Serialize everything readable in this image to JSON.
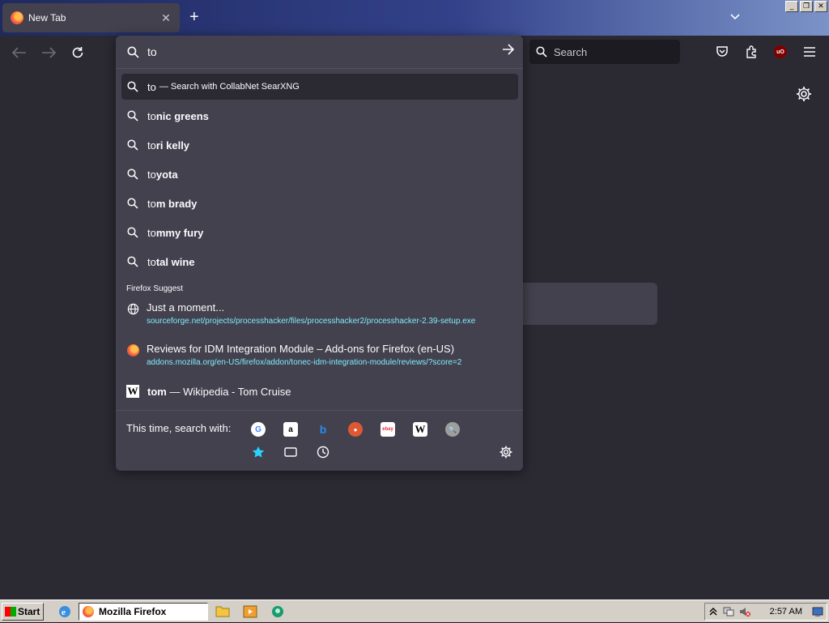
{
  "tab": {
    "title": "New Tab",
    "close": "✕"
  },
  "toolbar": {
    "search_placeholder": "Search"
  },
  "urlbar": {
    "typed": "to"
  },
  "results": {
    "heuristic": {
      "typed": "to",
      "suffix": "— Search with CollabNet SearXNG"
    },
    "suggestions": [
      {
        "prefix": "to",
        "completion": "nic greens"
      },
      {
        "prefix": "to",
        "completion": "ri kelly"
      },
      {
        "prefix": "to",
        "completion": "yota"
      },
      {
        "prefix": "to",
        "completion": "m brady"
      },
      {
        "prefix": "to",
        "completion": "mmy fury"
      },
      {
        "prefix": "to",
        "completion": "tal wine"
      }
    ],
    "group_label": "Firefox Suggest",
    "rich": [
      {
        "title": "Just a moment...",
        "url": "sourceforge.net/projects/processhacker/files/processhacker2/processhacker-2.39-setup.exe"
      },
      {
        "title": "Reviews for IDM Integration Module – Add-ons for Firefox (en-US)",
        "url": "addons.mozilla.org/en-US/firefox/addon/tonec-idm-integration-module/reviews/?score=2"
      }
    ],
    "wiki": {
      "typed": "tom",
      "rest": "— Wikipedia - Tom Cruise",
      "icon_letter": "W"
    }
  },
  "one_off": {
    "label": "This time, search with:",
    "engines": [
      {
        "name": "google",
        "glyph": "G",
        "bg": "#ffffff",
        "fg": "#4285f4"
      },
      {
        "name": "amazon",
        "glyph": "a",
        "bg": "#ffffff",
        "fg": "#000000"
      },
      {
        "name": "bing",
        "glyph": "b",
        "bg": "transparent",
        "fg": "#2a8be8"
      },
      {
        "name": "duckduckgo",
        "glyph": "●",
        "bg": "#de5833",
        "fg": "#ffffff"
      },
      {
        "name": "ebay",
        "glyph": "ebay",
        "bg": "#ffffff",
        "fg": "#e53238"
      },
      {
        "name": "wikipedia",
        "glyph": "W",
        "bg": "#ffffff",
        "fg": "#000000"
      },
      {
        "name": "searxng",
        "glyph": "🔍",
        "bg": "#9e9e9e",
        "fg": "#ffffff"
      }
    ],
    "local": [
      "bookmarks-star-icon",
      "tabs-icon",
      "history-clock-icon"
    ]
  },
  "taskbar": {
    "start_label": "Start",
    "task_label": "Mozilla Firefox",
    "clock": "2:57 AM"
  },
  "colors": {
    "accent_link": "#80ebff",
    "popup_bg": "#42414d",
    "toolbar_bg": "#2b2a33"
  }
}
